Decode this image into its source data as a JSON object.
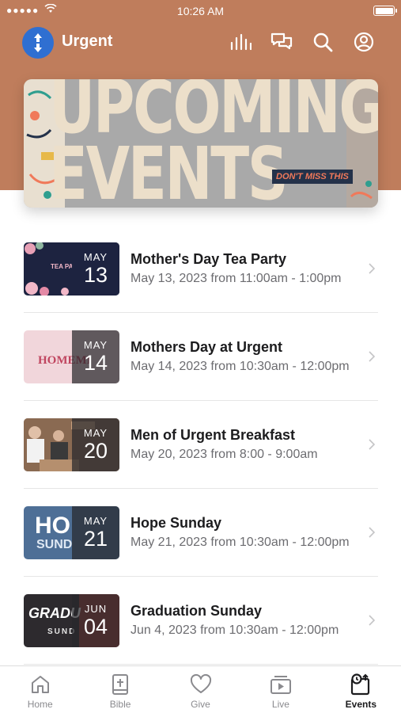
{
  "status_bar": {
    "signal": "●●●●●",
    "time": "10:26 AM"
  },
  "app": {
    "name": "Urgent"
  },
  "header_icons": [
    "audio-icon",
    "chat-icon",
    "search-icon",
    "profile-icon"
  ],
  "banner": {
    "line1": "UPCOMING",
    "line2": "EVENTS",
    "tag": "DON'T MISS THIS"
  },
  "events": [
    {
      "title": "Mother's Day Tea Party",
      "subtitle": "May 13, 2023 from 11:00am - 1:00pm",
      "month": "MAY",
      "day": "13"
    },
    {
      "title": "Mothers Day at Urgent",
      "subtitle": "May 14, 2023 from 10:30am - 12:00pm",
      "month": "MAY",
      "day": "14"
    },
    {
      "title": "Men of Urgent Breakfast",
      "subtitle": "May 20, 2023 from 8:00 - 9:00am",
      "month": "MAY",
      "day": "20"
    },
    {
      "title": "Hope Sunday",
      "subtitle": "May 21, 2023 from 10:30am - 12:00pm",
      "month": "MAY",
      "day": "21"
    },
    {
      "title": "Graduation Sunday",
      "subtitle": "Jun 4, 2023 from 10:30am - 12:00pm",
      "month": "JUN",
      "day": "04"
    }
  ],
  "thumb_art": {
    "tea": "TEA PARTY",
    "home": "HOMEMI",
    "hope1": "HO",
    "hope2": "SUND",
    "grad1": "GRADU",
    "grad2": "SUND"
  },
  "tabs": [
    {
      "label": "Home",
      "icon": "home-icon"
    },
    {
      "label": "Bible",
      "icon": "bible-icon"
    },
    {
      "label": "Give",
      "icon": "heart-icon"
    },
    {
      "label": "Live",
      "icon": "live-icon"
    },
    {
      "label": "Events",
      "icon": "events-icon",
      "active": true
    }
  ],
  "colors": {
    "header": "#bf7d5c",
    "logo": "#2f6fd1",
    "inactive": "#8a8a8e"
  }
}
